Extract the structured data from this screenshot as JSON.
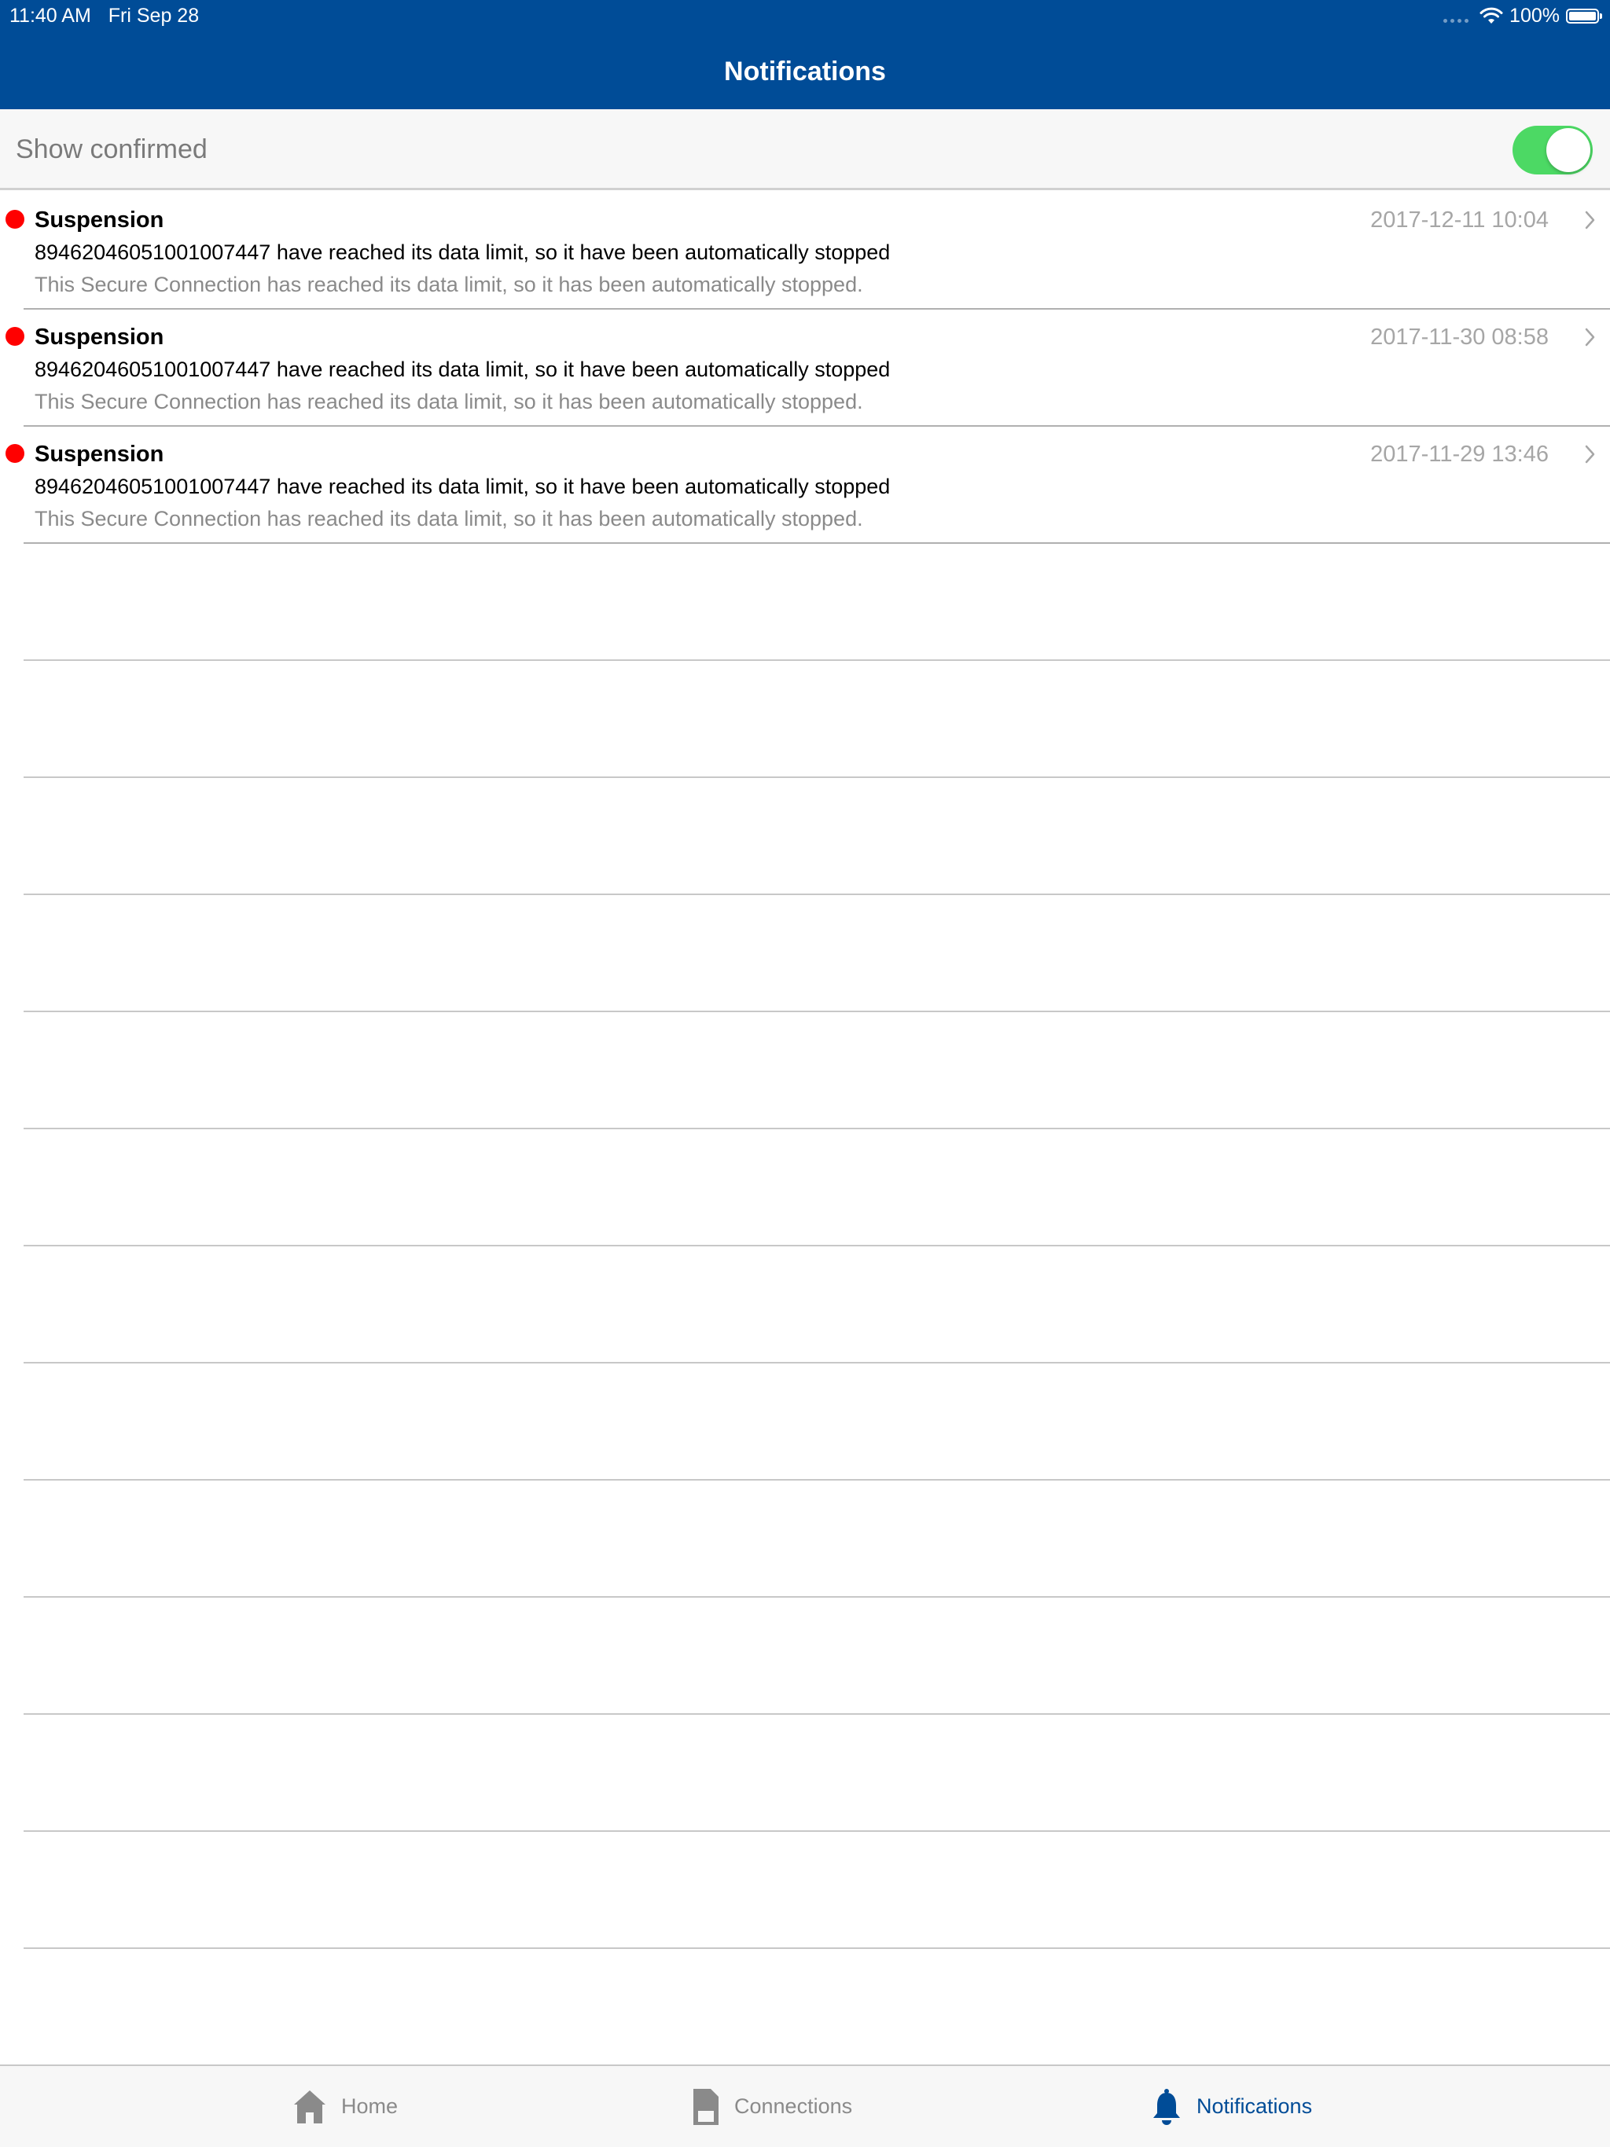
{
  "status_bar": {
    "time": "11:40 AM",
    "date": "Fri Sep 28",
    "battery": "100%"
  },
  "header": {
    "title": "Notifications"
  },
  "filter": {
    "label": "Show confirmed",
    "toggle_on": true
  },
  "notifications": [
    {
      "title": "Suspension",
      "date": "2017-12-11 10:04",
      "message": "89462046051001007447 have reached its data limit, so it have been automatically stopped",
      "detail": "This Secure Connection has reached its data limit, so it has been automatically stopped."
    },
    {
      "title": "Suspension",
      "date": "2017-11-30 08:58",
      "message": "89462046051001007447 have reached its data limit, so it have been automatically stopped",
      "detail": "This Secure Connection has reached its data limit, so it has been automatically stopped."
    },
    {
      "title": "Suspension",
      "date": "2017-11-29 13:46",
      "message": "89462046051001007447 have reached its data limit, so it have been automatically stopped",
      "detail": "This Secure Connection has reached its data limit, so it has been automatically stopped."
    }
  ],
  "tabs": [
    {
      "label": "Home",
      "icon": "house-icon",
      "active": false
    },
    {
      "label": "Connections",
      "icon": "sim-card-icon",
      "active": false
    },
    {
      "label": "Notifications",
      "icon": "bell-icon",
      "active": true
    }
  ],
  "colors": {
    "brand": "#004C97",
    "toggle_on": "#4CD964",
    "unread": "#FF0000",
    "tab_inactive": "#8A8A8A"
  }
}
